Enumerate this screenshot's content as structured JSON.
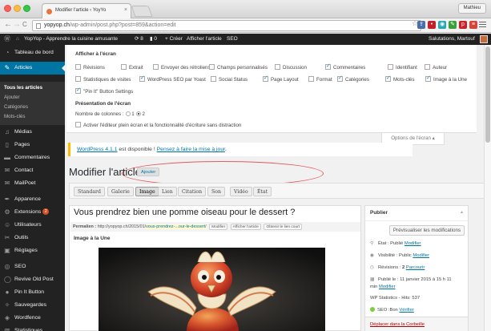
{
  "browser": {
    "tab_title": "Modifier l'article ‹ YoyYo",
    "tab_close": "×",
    "profile": "Mathieu",
    "url_host": "yopyop.ch",
    "url_path": "/wp-admin/post.php?post=859&action=edit",
    "back_glyph": "←",
    "forward_glyph": "→",
    "reload_glyph": "C",
    "star_glyph": "☆",
    "ext_icons": [
      {
        "name": "share-icon",
        "color": "#4a6ea9",
        "glyph": "⇪"
      },
      {
        "name": "lastpass-icon",
        "color": "#c32129",
        "glyph": "•"
      },
      {
        "name": "pocket-icon",
        "color": "#2aa7b6",
        "glyph": "◉"
      },
      {
        "name": "evernote-icon",
        "color": "#3c9e3c",
        "glyph": "✎"
      },
      {
        "name": "pinterest-icon",
        "color": "#cb2027",
        "glyph": "p"
      },
      {
        "name": "gmail-icon",
        "color": "#d44638",
        "glyph": "≡"
      }
    ]
  },
  "adminbar": {
    "wp_logo": "Ⓦ",
    "home_glyph": "⌂",
    "site_name": "YopYop - Apprendre la cuisine amusante",
    "updates": "⟳ 8",
    "comments": "▮ 0",
    "new_label": "+ Créer",
    "view_post": "Afficher l'article",
    "seo": "SEO",
    "greeting": "Salutations, Martouf"
  },
  "sidebar": {
    "items": [
      {
        "name": "sidebar-item-dashboard",
        "label": "Tableau de bord",
        "icon": "dashboard-icon",
        "glyph": "◔"
      },
      {
        "name": "sidebar-item-articles",
        "label": "Articles",
        "icon": "pin-icon",
        "glyph": "✎"
      },
      {
        "name": "sidebar-item-media",
        "label": "Médias",
        "icon": "media-icon",
        "glyph": "♫"
      },
      {
        "name": "sidebar-item-pages",
        "label": "Pages",
        "icon": "pages-icon",
        "glyph": "▯"
      },
      {
        "name": "sidebar-item-comments",
        "label": "Commentaires",
        "icon": "comments-icon",
        "glyph": "▬"
      },
      {
        "name": "sidebar-item-contact",
        "label": "Contact",
        "icon": "mail-icon",
        "glyph": "✉"
      },
      {
        "name": "sidebar-item-mailpoet",
        "label": "MailPoet",
        "icon": "mailpoet-icon",
        "glyph": "✉"
      },
      {
        "name": "sidebar-item-appearance",
        "label": "Apparence",
        "icon": "brush-icon",
        "glyph": "✒"
      },
      {
        "name": "sidebar-item-extensions",
        "label": "Extensions",
        "icon": "plugin-icon",
        "glyph": "⚙",
        "badge": "2"
      },
      {
        "name": "sidebar-item-users",
        "label": "Utilisateurs",
        "icon": "users-icon",
        "glyph": "☺"
      },
      {
        "name": "sidebar-item-tools",
        "label": "Outils",
        "icon": "wrench-icon",
        "glyph": "✂"
      },
      {
        "name": "sidebar-item-settings",
        "label": "Réglages",
        "icon": "settings-icon",
        "glyph": "▣"
      },
      {
        "name": "sidebar-item-seo",
        "label": "SEO",
        "icon": "yoast-icon",
        "glyph": "◎"
      },
      {
        "name": "sidebar-item-revive",
        "label": "Revive Old Post",
        "icon": "revive-icon",
        "glyph": "◯"
      },
      {
        "name": "sidebar-item-pinit",
        "label": "Pin It Button",
        "icon": "pinterest-icon",
        "glyph": "●"
      },
      {
        "name": "sidebar-item-backups",
        "label": "Sauvegardes",
        "icon": "backup-icon",
        "glyph": "✧"
      },
      {
        "name": "sidebar-item-wordfence",
        "label": "Wordfence",
        "icon": "wordfence-icon",
        "glyph": "◈"
      },
      {
        "name": "sidebar-item-statistics",
        "label": "Statistiques",
        "icon": "stats-icon",
        "glyph": "▥"
      }
    ],
    "submenu": [
      "Tous les articles",
      "Ajouter",
      "Catégories",
      "Mots-clés"
    ]
  },
  "screen_options": {
    "section1": "Afficher à l'écran",
    "checkboxes": [
      {
        "label": "Révisions",
        "checked": false
      },
      {
        "label": "Extrait",
        "checked": false
      },
      {
        "label": "Envoyer des rétroliens",
        "checked": false
      },
      {
        "label": "Champs personnalisés",
        "checked": false
      },
      {
        "label": "Discussion",
        "checked": false
      },
      {
        "label": "Commentaires",
        "checked": true
      },
      {
        "label": "Identifiant",
        "checked": false
      },
      {
        "label": "Auteur",
        "checked": false
      },
      {
        "label": "Statistiques de visites",
        "checked": false
      },
      {
        "label": "WordPress SEO par Yoast",
        "checked": true
      },
      {
        "label": "Social Status",
        "checked": false
      },
      {
        "label": "Page Layout",
        "checked": true
      },
      {
        "label": "Format",
        "checked": false
      },
      {
        "label": "Catégories",
        "checked": true
      },
      {
        "label": "Mots-clés",
        "checked": true
      },
      {
        "label": "Image à la Une",
        "checked": true
      },
      {
        "label": "\"Pin It\" Button Settings",
        "checked": true
      }
    ],
    "section2": "Présentation de l'écran",
    "columns_label": "Nombre de colonnes :",
    "col1": "1",
    "col2": "2",
    "distraction_free": "Activer l'éditeur plein écran et la fonctionnalité d'écriture sans distraction",
    "tab_label": "Options de l'écran ▴"
  },
  "notice": {
    "link1": "WordPress 4.1.1",
    "middle": " est disponible ! ",
    "link2": "Pensez à faire la mise à jour",
    "end": "."
  },
  "page": {
    "title": "Modifier l'article",
    "add_new": "Ajouter"
  },
  "format_tabs": [
    "Standard",
    "Galerie",
    "Image",
    "Lien",
    "Citation",
    "Son",
    "Vidéo",
    "État"
  ],
  "format_active": "Image",
  "editor": {
    "post_title": "Vous prendrez bien une pomme oiseau pour le dessert ?",
    "permalink_label": "Permalien :",
    "permalink_base": "http://yopyop.ch/2015/01/",
    "permalink_slug": "vous-prendrez-...our-le-dessert/",
    "btn_edit": "Modifier",
    "btn_view": "Afficher l'article",
    "btn_short": "Obtenir le lien court",
    "featured_label": "Image à la Une"
  },
  "publish": {
    "title": "Publier",
    "caret": "▴",
    "preview": "Prévisualiser les modifications",
    "status_label": "État : Publié ",
    "visibility_label": "Visibilité : Public ",
    "revisions_label": "Révisions : ",
    "revisions_count": "2",
    "browse": "Parcourir",
    "published_label": "Publié le : 11 janvier 2015 à 15 h 11",
    "min_label": "min ",
    "edit": "Modifier",
    "stats": "WP Statistics - Hits: 537",
    "seo_label": "SEO :Bon ",
    "verify": "Vérifier",
    "trash": "Déplacer dans la Corbeille"
  }
}
